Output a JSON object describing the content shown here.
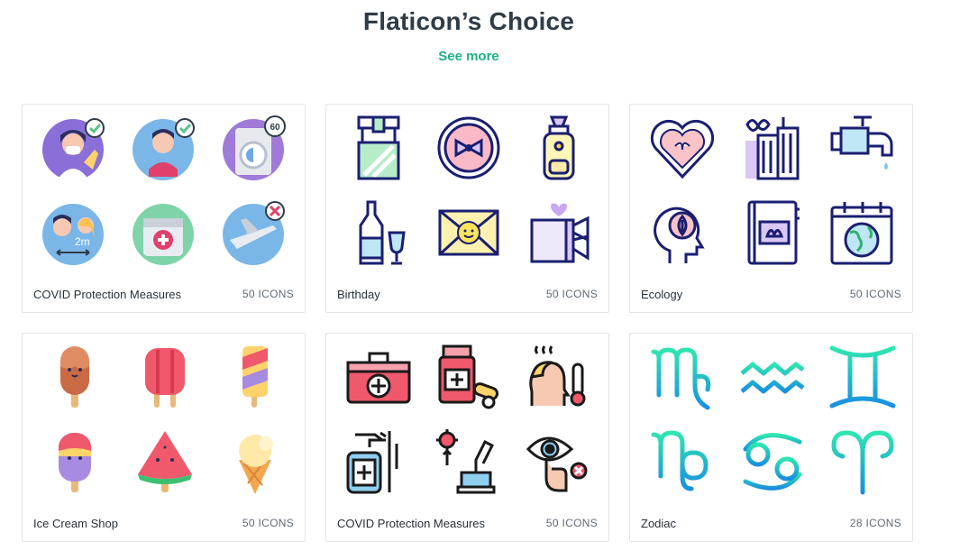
{
  "section": {
    "title": "Flaticon’s Choice",
    "see_more": "See more"
  },
  "collections": [
    {
      "name": "COVID Protection Measures",
      "count": "50 ICONS",
      "style": "flat-circle"
    },
    {
      "name": "Birthday",
      "count": "50 ICONS",
      "style": "lineal-color"
    },
    {
      "name": "Ecology",
      "count": "50 ICONS",
      "style": "lineal-color"
    },
    {
      "name": "Ice Cream Shop",
      "count": "50 ICONS",
      "style": "flat"
    },
    {
      "name": "COVID Protection Measures",
      "count": "50 ICONS",
      "style": "lineal-color"
    },
    {
      "name": "Zodiac",
      "count": "28 ICONS",
      "style": "gradient-line"
    }
  ],
  "icon_names": {
    "card1": [
      "face-mask-icon",
      "hand-washing-icon",
      "washing-machine-icon",
      "social-distance-icon",
      "first-aid-kit-icon",
      "no-flights-icon"
    ],
    "card2": [
      "gift-box-icon",
      "bow-plate-icon",
      "baby-bottle-icon",
      "champagne-icon",
      "invitation-envelope-icon",
      "present-icon"
    ],
    "card3": [
      "heart-leaf-icon",
      "green-building-icon",
      "water-tap-icon",
      "eco-mind-icon",
      "eco-book-icon",
      "earth-calendar-icon"
    ],
    "card4": [
      "popsicle-chocolate-icon",
      "popsicle-red-icon",
      "popsicle-stripes-icon",
      "ice-cream-bar-icon",
      "watermelon-popsicle-icon",
      "ice-cream-cone-icon"
    ],
    "card5": [
      "medical-kit-icon",
      "medicine-pills-icon",
      "fever-icon",
      "disinfectant-spray-icon",
      "virus-microscope-icon",
      "touch-eye-icon"
    ],
    "card6": [
      "virgo-icon",
      "aquarius-icon",
      "gemini-icon",
      "capricorn-icon",
      "cancer-icon",
      "aries-icon"
    ]
  },
  "colors": {
    "accent": "#1bb08a",
    "title": "#2f3b48",
    "navy": "#1a1f71",
    "zodiac_start": "#2ee6b0",
    "zodiac_end": "#1a8fe0"
  }
}
